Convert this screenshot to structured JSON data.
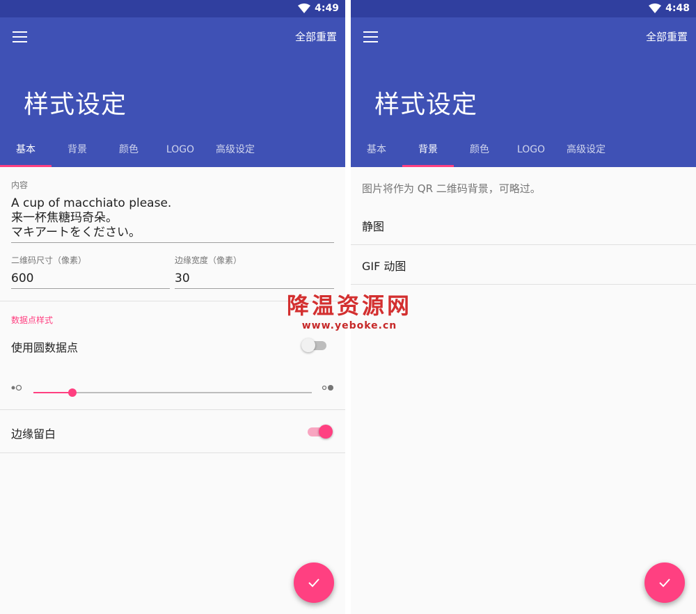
{
  "left": {
    "status_time": "4:49",
    "reset_label": "全部重置",
    "title": "样式设定",
    "tabs": [
      "基本",
      "背景",
      "颜色",
      "LOGO",
      "高级设定"
    ],
    "content_label": "内容",
    "content_value": "A cup of macchiato please.\n来一杯焦糖玛奇朵。\nマキアートをください。",
    "qr_size_label": "二维码尺寸（像素）",
    "qr_size_value": "600",
    "border_width_label": "边缘宽度（像素）",
    "border_width_value": "30",
    "dots_section_title": "数据点样式",
    "round_dots_label": "使用圆数据点",
    "round_dots_on": false,
    "dot_size_fraction": 0.14,
    "margin_label": "边缘留白",
    "margin_on": true
  },
  "right": {
    "status_time": "4:48",
    "reset_label": "全部重置",
    "title": "样式设定",
    "tabs": [
      "基本",
      "背景",
      "颜色",
      "LOGO",
      "高级设定"
    ],
    "description": "图片将作为 QR 二维码背景，可略过。",
    "items": [
      "静图",
      "GIF 动图"
    ]
  },
  "watermark": {
    "title": "降温资源网",
    "url": "www.yeboke.cn"
  },
  "colors": {
    "primary": "#3f51b5",
    "primary_dark": "#303f9f",
    "accent": "#ff4081"
  },
  "icons": {
    "menu": "menu-icon",
    "wifi": "wifi-icon",
    "check": "check-icon"
  }
}
